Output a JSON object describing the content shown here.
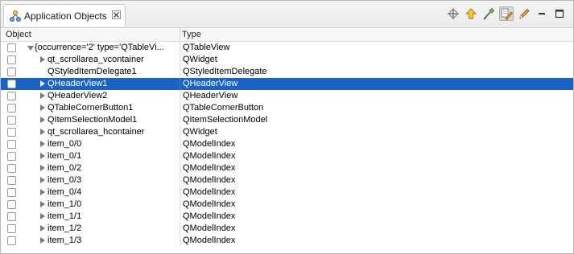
{
  "tab": {
    "title": "Application Objects",
    "icon": "objects-tree-icon",
    "close_icon": "close-icon"
  },
  "toolbar": {
    "buttons": [
      {
        "name": "highlight-object-icon",
        "active": false
      },
      {
        "name": "arrow-up-icon",
        "active": false
      },
      {
        "name": "pick-object-icon",
        "active": false
      },
      {
        "name": "edit-properties-icon",
        "active": true
      },
      {
        "name": "pencil-icon",
        "active": false
      },
      {
        "name": "minimize-icon",
        "active": false
      },
      {
        "name": "maximize-icon",
        "active": false
      }
    ]
  },
  "columns": {
    "object": "Object",
    "type": "Type"
  },
  "rows": [
    {
      "object": "{occurrence='2' type='QTableVi...",
      "type": "QTableView",
      "level": 0,
      "expanded": true,
      "selected": false
    },
    {
      "object": "qt_scrollarea_vcontainer",
      "type": "QWidget",
      "level": 1,
      "expanded": false,
      "selected": false
    },
    {
      "object": "QStyledItemDelegate1",
      "type": "QStyledItemDelegate",
      "level": 1,
      "expanded": null,
      "selected": false
    },
    {
      "object": "QHeaderView1",
      "type": "QHeaderView",
      "level": 1,
      "expanded": false,
      "selected": true
    },
    {
      "object": "QHeaderView2",
      "type": "QHeaderView",
      "level": 1,
      "expanded": false,
      "selected": false
    },
    {
      "object": "QTableCornerButton1",
      "type": "QTableCornerButton",
      "level": 1,
      "expanded": false,
      "selected": false
    },
    {
      "object": "QItemSelectionModel1",
      "type": "QItemSelectionModel",
      "level": 1,
      "expanded": false,
      "selected": false
    },
    {
      "object": "qt_scrollarea_hcontainer",
      "type": "QWidget",
      "level": 1,
      "expanded": false,
      "selected": false
    },
    {
      "object": "item_0/0",
      "type": "QModelIndex",
      "level": 1,
      "expanded": false,
      "selected": false
    },
    {
      "object": "item_0/1",
      "type": "QModelIndex",
      "level": 1,
      "expanded": false,
      "selected": false
    },
    {
      "object": "item_0/2",
      "type": "QModelIndex",
      "level": 1,
      "expanded": false,
      "selected": false
    },
    {
      "object": "item_0/3",
      "type": "QModelIndex",
      "level": 1,
      "expanded": false,
      "selected": false
    },
    {
      "object": "item_0/4",
      "type": "QModelIndex",
      "level": 1,
      "expanded": false,
      "selected": false
    },
    {
      "object": "item_1/0",
      "type": "QModelIndex",
      "level": 1,
      "expanded": false,
      "selected": false
    },
    {
      "object": "item_1/1",
      "type": "QModelIndex",
      "level": 1,
      "expanded": false,
      "selected": false
    },
    {
      "object": "item_1/2",
      "type": "QModelIndex",
      "level": 1,
      "expanded": false,
      "selected": false
    },
    {
      "object": "item_1/3",
      "type": "QModelIndex",
      "level": 1,
      "expanded": false,
      "selected": false
    }
  ],
  "colors": {
    "selection": "#1b62c6",
    "selection_text": "#ffffff"
  }
}
